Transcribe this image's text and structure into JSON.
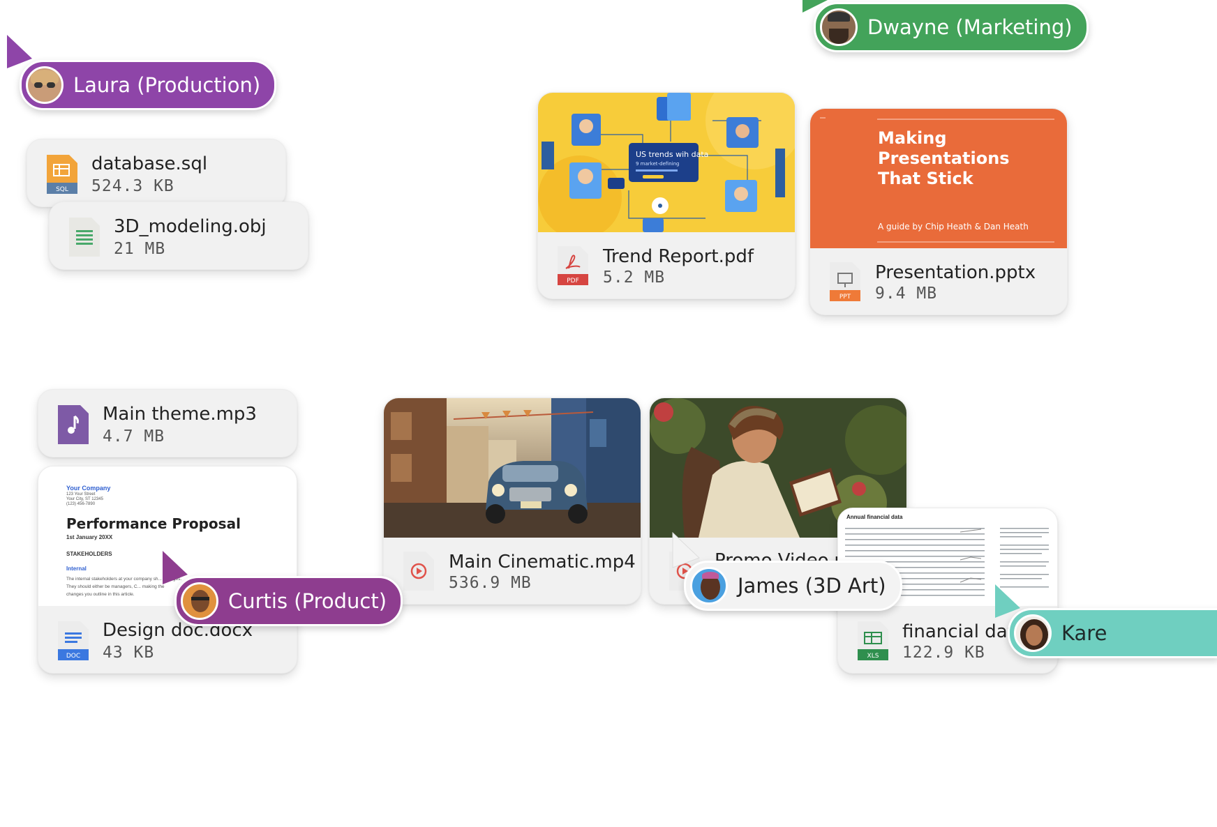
{
  "files": [
    {
      "name": "database.sql",
      "size": "524.3 KB",
      "icon": "sql-file-icon",
      "tag": "SQL"
    },
    {
      "name": "3D_modeling.obj",
      "size": "21 MB",
      "icon": "obj-file-icon"
    },
    {
      "name": "Trend Report.pdf",
      "size": "5.2 MB",
      "icon": "pdf-file-icon",
      "tag": "PDF"
    },
    {
      "name": "Presentation.pptx",
      "size": "9.4 MB",
      "icon": "ppt-file-icon",
      "tag": "PPT"
    },
    {
      "name": "Main theme.mp3",
      "size": "4.7 MB",
      "icon": "audio-file-icon"
    },
    {
      "name": "Design doc.docx",
      "size": "43 KB",
      "icon": "doc-file-icon",
      "tag": "DOC"
    },
    {
      "name": "Main Cinematic.mp4",
      "size": "536.9 MB",
      "icon": "video-file-icon"
    },
    {
      "name": "Promo Video.mp4",
      "size": "",
      "icon": "video-file-icon"
    },
    {
      "name": "financial data",
      "size": "122.9 KB",
      "icon": "xls-file-icon",
      "tag": "XLS"
    }
  ],
  "previews": {
    "trend": {
      "title": "US trends wih data",
      "subtitle": "9 market-defining"
    },
    "presentation": {
      "title": "Making Presentations That Stick",
      "subtitle": "A guide by Chip Heath & Dan Heath"
    },
    "design": {
      "company": "Your Company",
      "address1": "123 Your Street",
      "address2": "Your City, ST 12345",
      "phone": "(123) 456-7890",
      "title": "Performance Proposal",
      "date": "1st January 20XX",
      "section": "STAKEHOLDERS",
      "subsection": "Internal",
      "body": "The internal stakeholders at your company sh... changes. They should either be managers, C... making the changes you outline in this article."
    },
    "financial": {
      "title": "Annual financial data"
    }
  },
  "collaborators": [
    {
      "name": "Laura (Production)",
      "color": "#8e45a8"
    },
    {
      "name": "Dwayne (Marketing)",
      "color": "#43a35a"
    },
    {
      "name": "Curtis (Product)",
      "color": "#8e3d8f"
    },
    {
      "name": "James (3D Art)",
      "color": "#f3f3f3"
    },
    {
      "name": "Kare",
      "color": "#6fcfc0"
    }
  ]
}
